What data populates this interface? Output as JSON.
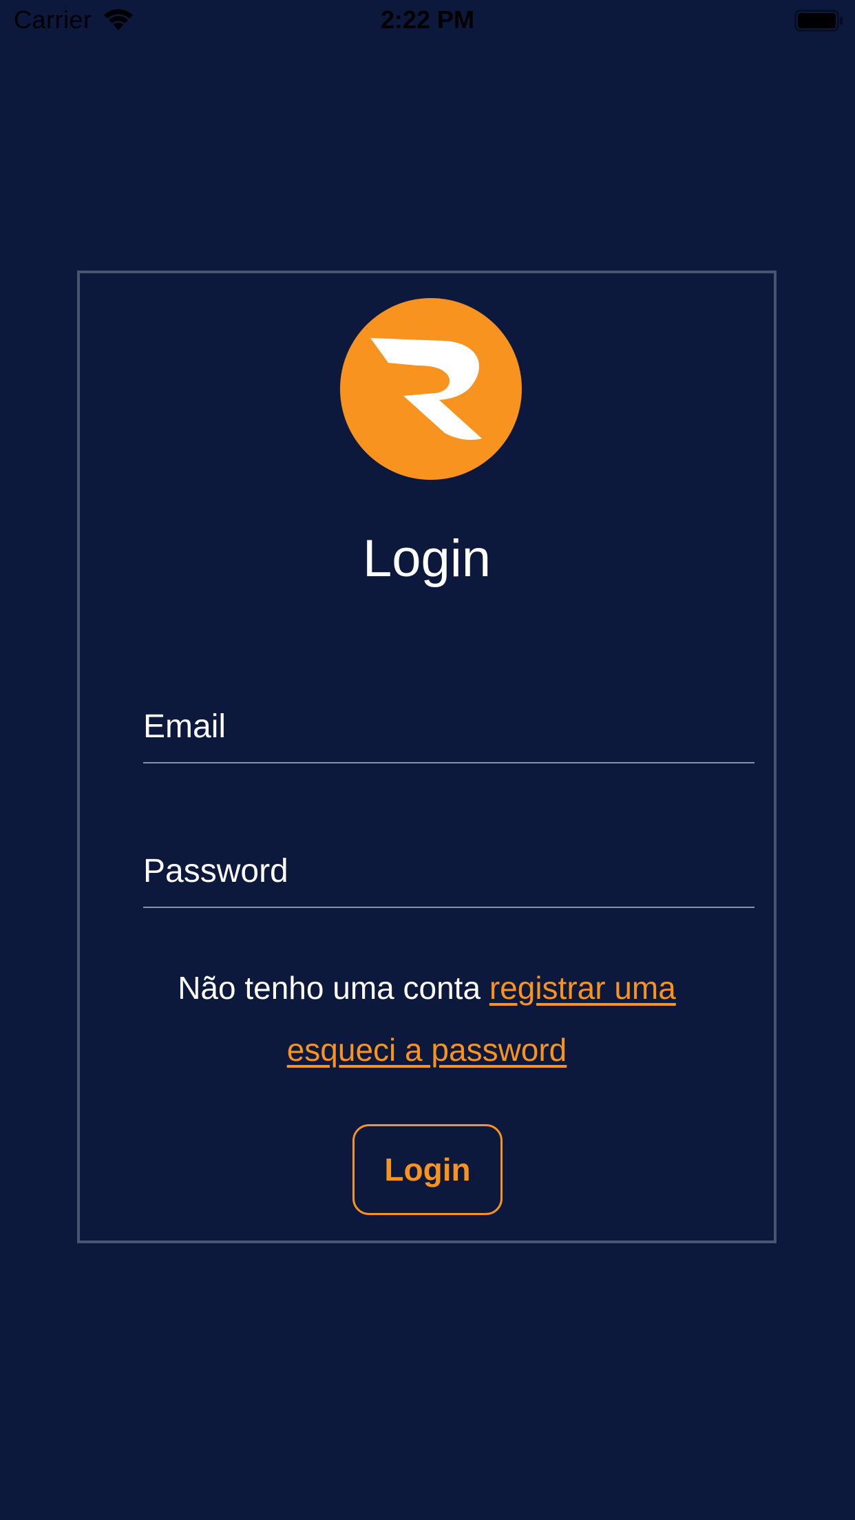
{
  "status_bar": {
    "carrier": "Carrier",
    "time": "2:22 PM",
    "icons": [
      "wifi-icon",
      "battery-icon"
    ]
  },
  "login": {
    "logo": {
      "icon": "brand-logo",
      "letter": "R",
      "color": "#f7931e"
    },
    "title": "Login",
    "email": {
      "placeholder": "Email",
      "value": ""
    },
    "password": {
      "placeholder": "Password",
      "value": ""
    },
    "register_prompt": "Não tenho uma conta ",
    "register_link": "registrar uma",
    "forgot_link": "esqueci a password",
    "submit_label": "Login"
  },
  "colors": {
    "background": "#0c193d",
    "accent": "#f7931e",
    "text": "#ffffff",
    "card_border": "#4a5670"
  }
}
